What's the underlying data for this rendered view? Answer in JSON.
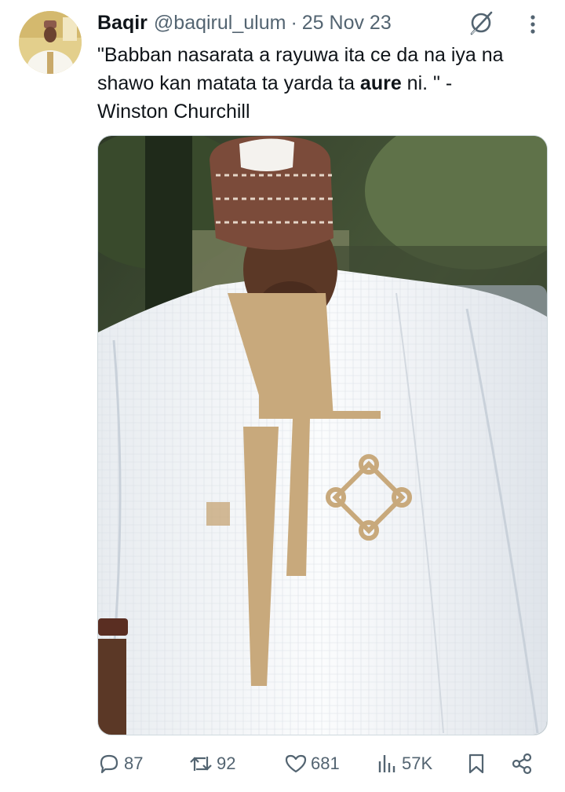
{
  "author": {
    "display_name": "Baqir",
    "handle": "@baqirul_ulum",
    "separator": "·",
    "date": "25 Nov 23"
  },
  "tweet": {
    "text_before_bold": "\"Babban nasarata a rayuwa ita ce da na iya na shawo kan matata ta yarda ta ",
    "text_bold": "aure",
    "text_after_bold": " ni. \" -",
    "attribution": "Winston Churchill"
  },
  "actions": {
    "replies": "87",
    "reposts": "92",
    "likes": "681",
    "views": "57K"
  },
  "colors": {
    "text_primary": "#0f1419",
    "text_secondary": "#536471",
    "border": "#cfd9de"
  },
  "icons": [
    "grok-icon",
    "more-options-icon",
    "reply-icon",
    "repost-icon",
    "like-icon",
    "views-icon",
    "bookmark-icon",
    "share-icon"
  ]
}
